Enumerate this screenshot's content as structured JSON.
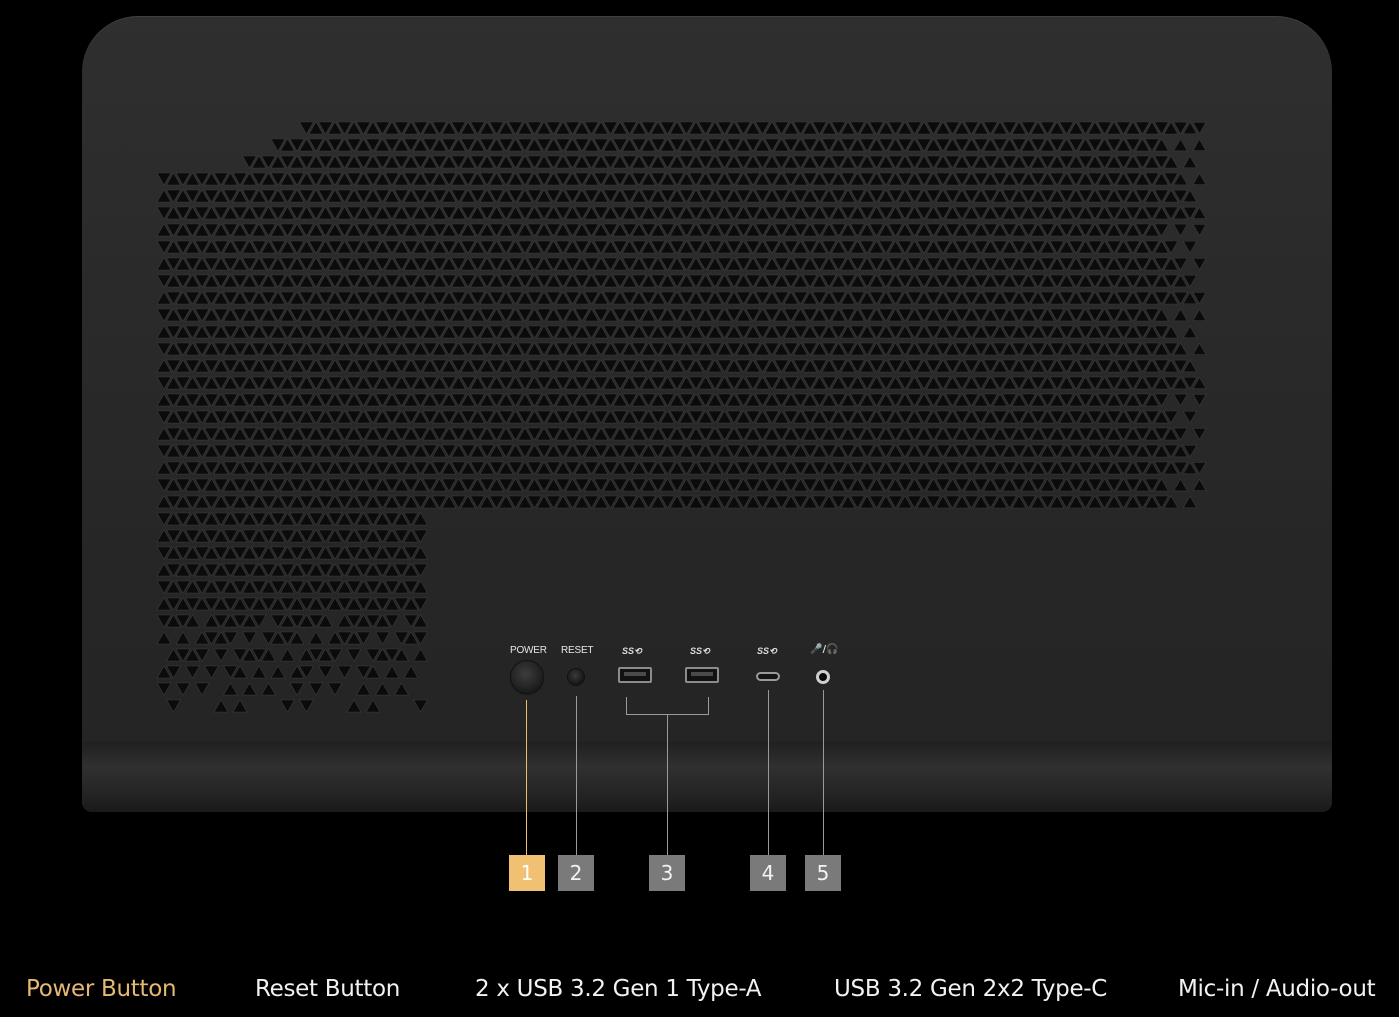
{
  "panel": {
    "power_label": "POWER",
    "reset_label": "RESET",
    "usb_a1_logo": "SS⟲",
    "usb_a2_logo": "SS⟲",
    "usb_c_logo": "SS⟲",
    "audio_logo": "🎤/🎧"
  },
  "callouts": [
    {
      "number": "1",
      "label": "Power Button",
      "active": true
    },
    {
      "number": "2",
      "label": "Reset Button",
      "active": false
    },
    {
      "number": "3",
      "label": "2 x USB 3.2 Gen 1 Type-A",
      "active": false
    },
    {
      "number": "4",
      "label": "USB 3.2 Gen 2x2 Type-C",
      "active": false
    },
    {
      "number": "5",
      "label": "Mic-in / Audio-out",
      "active": false
    }
  ],
  "colors": {
    "background": "#000000",
    "chassis": "#2b2b2b",
    "accent": "#f0c173",
    "badge": "#7a7a7a"
  }
}
